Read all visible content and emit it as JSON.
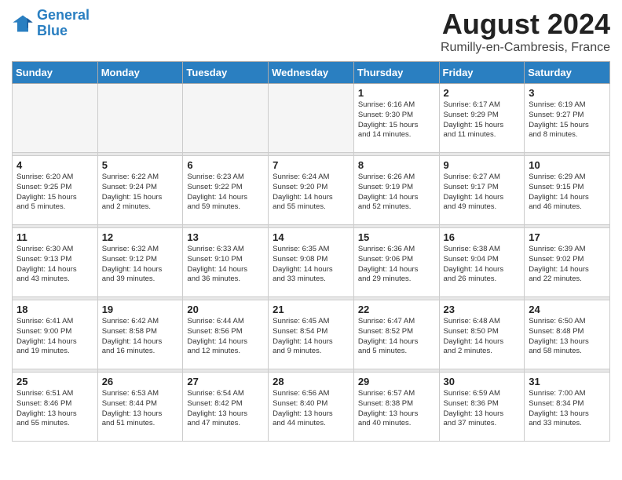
{
  "logo": {
    "line1": "General",
    "line2": "Blue"
  },
  "title": "August 2024",
  "location": "Rumilly-en-Cambresis, France",
  "weekdays": [
    "Sunday",
    "Monday",
    "Tuesday",
    "Wednesday",
    "Thursday",
    "Friday",
    "Saturday"
  ],
  "weeks": [
    [
      {
        "day": "",
        "details": ""
      },
      {
        "day": "",
        "details": ""
      },
      {
        "day": "",
        "details": ""
      },
      {
        "day": "",
        "details": ""
      },
      {
        "day": "1",
        "details": "Sunrise: 6:16 AM\nSunset: 9:30 PM\nDaylight: 15 hours\nand 14 minutes."
      },
      {
        "day": "2",
        "details": "Sunrise: 6:17 AM\nSunset: 9:29 PM\nDaylight: 15 hours\nand 11 minutes."
      },
      {
        "day": "3",
        "details": "Sunrise: 6:19 AM\nSunset: 9:27 PM\nDaylight: 15 hours\nand 8 minutes."
      }
    ],
    [
      {
        "day": "4",
        "details": "Sunrise: 6:20 AM\nSunset: 9:25 PM\nDaylight: 15 hours\nand 5 minutes."
      },
      {
        "day": "5",
        "details": "Sunrise: 6:22 AM\nSunset: 9:24 PM\nDaylight: 15 hours\nand 2 minutes."
      },
      {
        "day": "6",
        "details": "Sunrise: 6:23 AM\nSunset: 9:22 PM\nDaylight: 14 hours\nand 59 minutes."
      },
      {
        "day": "7",
        "details": "Sunrise: 6:24 AM\nSunset: 9:20 PM\nDaylight: 14 hours\nand 55 minutes."
      },
      {
        "day": "8",
        "details": "Sunrise: 6:26 AM\nSunset: 9:19 PM\nDaylight: 14 hours\nand 52 minutes."
      },
      {
        "day": "9",
        "details": "Sunrise: 6:27 AM\nSunset: 9:17 PM\nDaylight: 14 hours\nand 49 minutes."
      },
      {
        "day": "10",
        "details": "Sunrise: 6:29 AM\nSunset: 9:15 PM\nDaylight: 14 hours\nand 46 minutes."
      }
    ],
    [
      {
        "day": "11",
        "details": "Sunrise: 6:30 AM\nSunset: 9:13 PM\nDaylight: 14 hours\nand 43 minutes."
      },
      {
        "day": "12",
        "details": "Sunrise: 6:32 AM\nSunset: 9:12 PM\nDaylight: 14 hours\nand 39 minutes."
      },
      {
        "day": "13",
        "details": "Sunrise: 6:33 AM\nSunset: 9:10 PM\nDaylight: 14 hours\nand 36 minutes."
      },
      {
        "day": "14",
        "details": "Sunrise: 6:35 AM\nSunset: 9:08 PM\nDaylight: 14 hours\nand 33 minutes."
      },
      {
        "day": "15",
        "details": "Sunrise: 6:36 AM\nSunset: 9:06 PM\nDaylight: 14 hours\nand 29 minutes."
      },
      {
        "day": "16",
        "details": "Sunrise: 6:38 AM\nSunset: 9:04 PM\nDaylight: 14 hours\nand 26 minutes."
      },
      {
        "day": "17",
        "details": "Sunrise: 6:39 AM\nSunset: 9:02 PM\nDaylight: 14 hours\nand 22 minutes."
      }
    ],
    [
      {
        "day": "18",
        "details": "Sunrise: 6:41 AM\nSunset: 9:00 PM\nDaylight: 14 hours\nand 19 minutes."
      },
      {
        "day": "19",
        "details": "Sunrise: 6:42 AM\nSunset: 8:58 PM\nDaylight: 14 hours\nand 16 minutes."
      },
      {
        "day": "20",
        "details": "Sunrise: 6:44 AM\nSunset: 8:56 PM\nDaylight: 14 hours\nand 12 minutes."
      },
      {
        "day": "21",
        "details": "Sunrise: 6:45 AM\nSunset: 8:54 PM\nDaylight: 14 hours\nand 9 minutes."
      },
      {
        "day": "22",
        "details": "Sunrise: 6:47 AM\nSunset: 8:52 PM\nDaylight: 14 hours\nand 5 minutes."
      },
      {
        "day": "23",
        "details": "Sunrise: 6:48 AM\nSunset: 8:50 PM\nDaylight: 14 hours\nand 2 minutes."
      },
      {
        "day": "24",
        "details": "Sunrise: 6:50 AM\nSunset: 8:48 PM\nDaylight: 13 hours\nand 58 minutes."
      }
    ],
    [
      {
        "day": "25",
        "details": "Sunrise: 6:51 AM\nSunset: 8:46 PM\nDaylight: 13 hours\nand 55 minutes."
      },
      {
        "day": "26",
        "details": "Sunrise: 6:53 AM\nSunset: 8:44 PM\nDaylight: 13 hours\nand 51 minutes."
      },
      {
        "day": "27",
        "details": "Sunrise: 6:54 AM\nSunset: 8:42 PM\nDaylight: 13 hours\nand 47 minutes."
      },
      {
        "day": "28",
        "details": "Sunrise: 6:56 AM\nSunset: 8:40 PM\nDaylight: 13 hours\nand 44 minutes."
      },
      {
        "day": "29",
        "details": "Sunrise: 6:57 AM\nSunset: 8:38 PM\nDaylight: 13 hours\nand 40 minutes."
      },
      {
        "day": "30",
        "details": "Sunrise: 6:59 AM\nSunset: 8:36 PM\nDaylight: 13 hours\nand 37 minutes."
      },
      {
        "day": "31",
        "details": "Sunrise: 7:00 AM\nSunset: 8:34 PM\nDaylight: 13 hours\nand 33 minutes."
      }
    ]
  ]
}
